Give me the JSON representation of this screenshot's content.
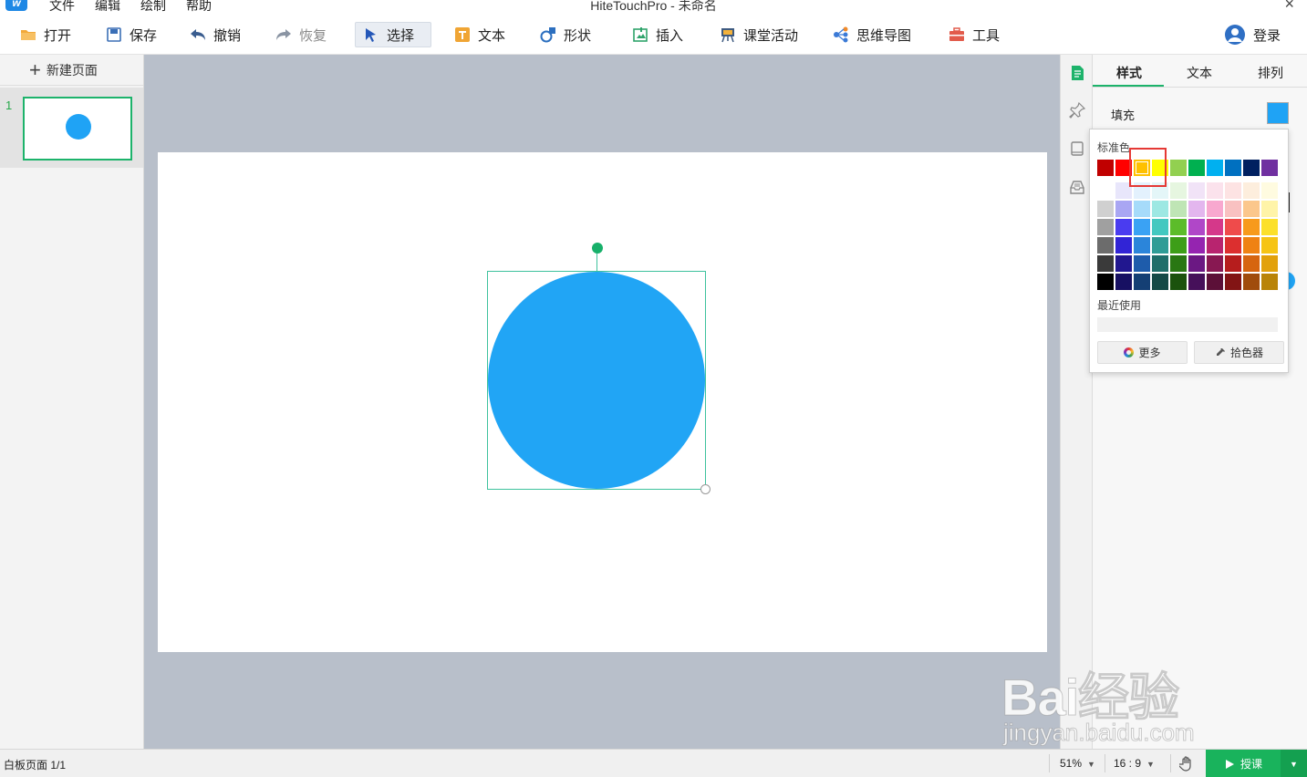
{
  "titlebar": {
    "app_logo": "app-logo",
    "menus": [
      "文件",
      "编辑",
      "绘制",
      "帮助"
    ],
    "title": "HiteTouchPro - 未命名",
    "close": "×"
  },
  "toolbar": {
    "open": "打开",
    "save": "保存",
    "undo": "撤销",
    "redo": "恢复",
    "select": "选择",
    "text": "文本",
    "shape": "形状",
    "insert": "插入",
    "activity": "课堂活动",
    "mindmap": "思维导图",
    "tools": "工具",
    "login": "登录"
  },
  "left": {
    "new_page": "新建页面",
    "slides": [
      {
        "num": "1"
      }
    ]
  },
  "right": {
    "tabs": [
      "样式",
      "文本",
      "排列"
    ],
    "active_tab": "样式",
    "fill_label": "填充",
    "fill_color": "#1fa3f5"
  },
  "color_popup": {
    "standard_title": "标准色",
    "standard_colors": [
      "#c00000",
      "#ff0000",
      "#ffc000",
      "#ffff00",
      "#92d050",
      "#00b050",
      "#00b0f0",
      "#0070c0",
      "#002060",
      "#7030a0"
    ],
    "selected_color": "#ffc000",
    "theme_grid": [
      [
        "#ffffff",
        "#e8e6fb",
        "#e3f1fd",
        "#e4f6f8",
        "#e6f6e0",
        "#f1e3f7",
        "#fbe2ec",
        "#fde3e3",
        "#fdeedd",
        "#fffbe0"
      ],
      [
        "#d0d0d0",
        "#a9a6f3",
        "#a6dbfa",
        "#9de8e3",
        "#bfe5b5",
        "#e3b6ee",
        "#f8a8cf",
        "#f9c1c1",
        "#fbc78c",
        "#fff4a8"
      ],
      [
        "#a0a0a0",
        "#4a3cf0",
        "#3aa2f4",
        "#43c8c0",
        "#5cbc2a",
        "#b047c8",
        "#d5388a",
        "#ef4b4b",
        "#f79a1c",
        "#fce02a"
      ],
      [
        "#6c6c6c",
        "#3124d6",
        "#2b85da",
        "#2f9c96",
        "#3d9e18",
        "#9524b0",
        "#b8246f",
        "#dc2f2f",
        "#ef8213",
        "#f6c414"
      ],
      [
        "#3a3a3a",
        "#21178f",
        "#1e5cab",
        "#1f6e6a",
        "#297713",
        "#6b1883",
        "#881852",
        "#b61d1d",
        "#d66510",
        "#e2a10b"
      ],
      [
        "#000000",
        "#171062",
        "#143f74",
        "#154a47",
        "#1b520d",
        "#46105a",
        "#5c1038",
        "#821414",
        "#a04c0c",
        "#b98408"
      ]
    ],
    "recent_title": "最近使用",
    "more": "更多",
    "picker": "拾色器"
  },
  "canvas": {
    "shape": "circle",
    "shape_color": "#21a5f5",
    "selection_color": "#3ec29d",
    "background": "#b8bfca"
  },
  "status": {
    "page_text": "白板页面 1/1",
    "zoom": "51%",
    "ratio": "16 : 9",
    "teach": "授课"
  },
  "watermark": {
    "text": "Bai经验",
    "sub": "jingyan.baidu.com"
  }
}
